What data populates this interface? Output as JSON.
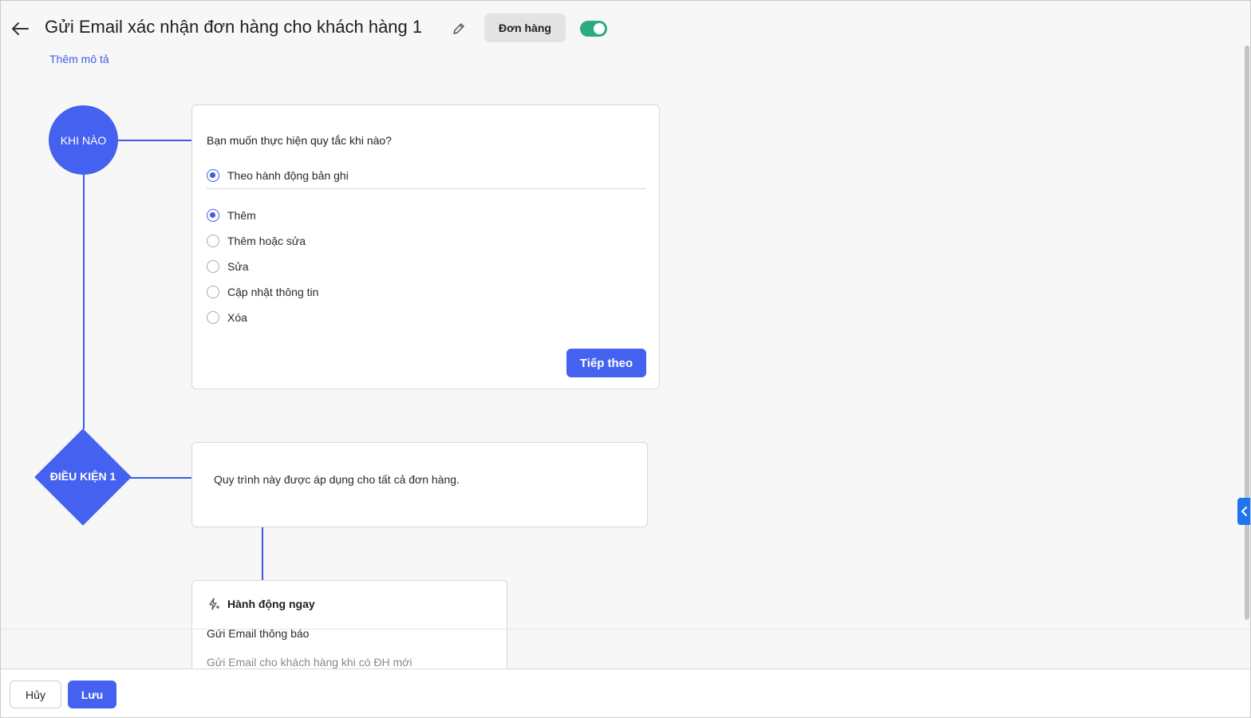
{
  "header": {
    "title": "Gửi Email xác nhận đơn hàng cho khách hàng 1",
    "module_badge": "Đơn hàng",
    "active_toggle_on": true,
    "add_description": "Thêm mô tả"
  },
  "flow": {
    "when_node_label": "KHI NÀO",
    "condition_node_label": "ĐIỀU KIỆN 1"
  },
  "when_card": {
    "question": "Bạn muốn thực hiện quy tắc khi nào?",
    "trigger_option": "Theo hành động bản ghi",
    "options": [
      {
        "label": "Thêm",
        "checked": true
      },
      {
        "label": "Thêm hoặc sửa",
        "checked": false
      },
      {
        "label": "Sửa",
        "checked": false
      },
      {
        "label": "Cập nhật thông tin",
        "checked": false
      },
      {
        "label": "Xóa",
        "checked": false
      }
    ],
    "next_button": "Tiếp theo"
  },
  "condition_card": {
    "text": "Quy trình này được áp dụng cho tất cả đơn hàng."
  },
  "action_card": {
    "heading": "Hành động ngay",
    "action_name": "Gửi Email thông báo",
    "action_desc": "Gửi Email cho khách hàng khi có ĐH mới"
  },
  "footer": {
    "cancel": "Hủy",
    "save": "Lưu"
  },
  "colors": {
    "primary": "#4462ef",
    "link": "#3f5fe3",
    "toggle_on": "#2bab84",
    "side_tab": "#1f74f0"
  },
  "icons": {
    "back": "back-arrow-icon",
    "edit": "pencil-icon",
    "action": "lightning-sparkle-icon",
    "side_tab": "chevron-left-icon"
  }
}
